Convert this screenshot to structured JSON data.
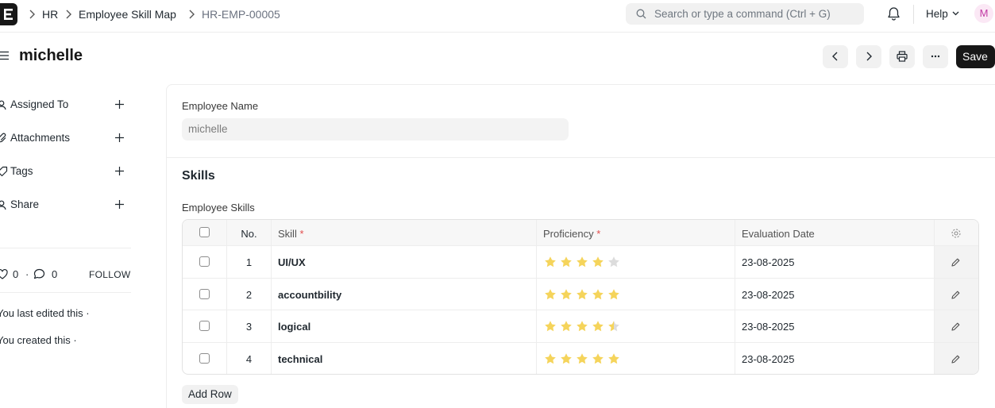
{
  "navbar": {
    "logo_letter": "E",
    "breadcrumbs": [
      "HR",
      "Employee Skill Map",
      "HR-EMP-00005"
    ],
    "search_placeholder": "Search or type a command (Ctrl + G)",
    "help_label": "Help",
    "avatar_initial": "M"
  },
  "header": {
    "title": "michelle",
    "save_label": "Save"
  },
  "sidebar": {
    "items": [
      {
        "label": "Assigned To",
        "icon": "assign-user-icon"
      },
      {
        "label": "Attachments",
        "icon": "paperclip-icon"
      },
      {
        "label": "Tags",
        "icon": "tag-icon"
      },
      {
        "label": "Share",
        "icon": "share-icon"
      }
    ],
    "likes": "0",
    "dot": "·",
    "comments": "0",
    "follow_label": "FOLLOW",
    "last_edited": "You last edited this ·",
    "created": "You created this ·"
  },
  "form": {
    "employee_name_label": "Employee Name",
    "employee_name_value": "michelle",
    "section_title": "Skills",
    "table_label": "Employee Skills",
    "columns": {
      "no": "No.",
      "skill": "Skill",
      "proficiency": "Proficiency",
      "evaluation_date": "Evaluation Date",
      "required_mark": "*"
    },
    "rows": [
      {
        "no": "1",
        "skill": "UI/UX",
        "rating": 4,
        "date": "23-08-2025"
      },
      {
        "no": "2",
        "skill": "accountbility",
        "rating": 5,
        "date": "23-08-2025"
      },
      {
        "no": "3",
        "skill": "logical",
        "rating": 4.5,
        "date": "23-08-2025"
      },
      {
        "no": "4",
        "skill": "technical",
        "rating": 5,
        "date": "23-08-2025"
      }
    ],
    "add_row_label": "Add Row"
  },
  "colors": {
    "star_filled": "#f5d45b",
    "star_empty": "#dcdcdc",
    "primary_button": "#171717",
    "required": "#e24c4c"
  }
}
